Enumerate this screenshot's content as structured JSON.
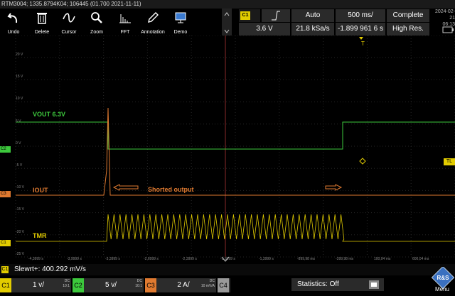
{
  "titlebar": "RTM3004; 1335.8794K04; 106445 (01.700 2021-11-11)",
  "toolbar": [
    {
      "label": "Undo",
      "icon": "undo-icon"
    },
    {
      "label": "Delete",
      "icon": "trash-icon"
    },
    {
      "label": "Cursor",
      "icon": "cursor-icon"
    },
    {
      "label": "Zoom",
      "icon": "zoom-icon"
    },
    {
      "label": "FFT",
      "icon": "fft-icon"
    },
    {
      "label": "Annotation",
      "icon": "annotation-icon"
    },
    {
      "label": "Demo",
      "icon": "demo-icon"
    }
  ],
  "trigger": {
    "channel": "C1",
    "edge_icon": "rising-edge-icon",
    "mode": "Auto",
    "timebase": "500 ms/",
    "state": "Complete",
    "level": "3.6 V",
    "sample_rate": "21.8 kSa/s",
    "position": "-1.899 961 6 s",
    "resolution": "High Res."
  },
  "datetime": {
    "date": "2024-02-21",
    "time": "06:13"
  },
  "markers": {
    "trigger_time": "T",
    "trigger_level": "TL"
  },
  "plot": {
    "y_labels": [
      "20 V",
      "15 V",
      "10 V",
      "5 V",
      "0 V",
      "-5 V",
      "-10 V",
      "-15 V",
      "-20 V",
      "-25 V"
    ],
    "x_labels": [
      "-4,3999 s",
      "-3,9999 s",
      "-3,3999 s",
      "-2,6999 s",
      "-2,3999 s",
      "-1,9999 s",
      "-1,3999 s",
      "-899,98 ms",
      "-399,98 ms",
      "100,04 ms",
      "600,04 ms"
    ],
    "channels": [
      {
        "name": "VOUT 6.3V",
        "color": "#3cc83c",
        "tag": "C2"
      },
      {
        "name": "IOUT",
        "color": "#e07a30",
        "tag": "C3"
      },
      {
        "name": "TMR",
        "color": "#e2cc00",
        "tag": "C1"
      }
    ],
    "annotation": "Shorted output"
  },
  "status": {
    "badge": "C1",
    "text": "Slewrt+: 400.292 mV/s"
  },
  "bottom": {
    "channels": [
      {
        "tag": "C1",
        "value": "1 v/",
        "coupling": "DC",
        "coupling2": "10:1",
        "color": "#e2cc00"
      },
      {
        "tag": "C2",
        "value": "5 v/",
        "coupling": "DC",
        "coupling2": "10:1",
        "color": "#3cc83c"
      },
      {
        "tag": "C3",
        "value": "2 A/",
        "coupling": "DC",
        "coupling2": "10 mV/A",
        "color": "#e07a30"
      },
      {
        "tag": "C4",
        "value": "",
        "coupling": "",
        "coupling2": "",
        "color": "#888888"
      }
    ],
    "statistics": "Statistics: Off",
    "menu": "Menu"
  }
}
